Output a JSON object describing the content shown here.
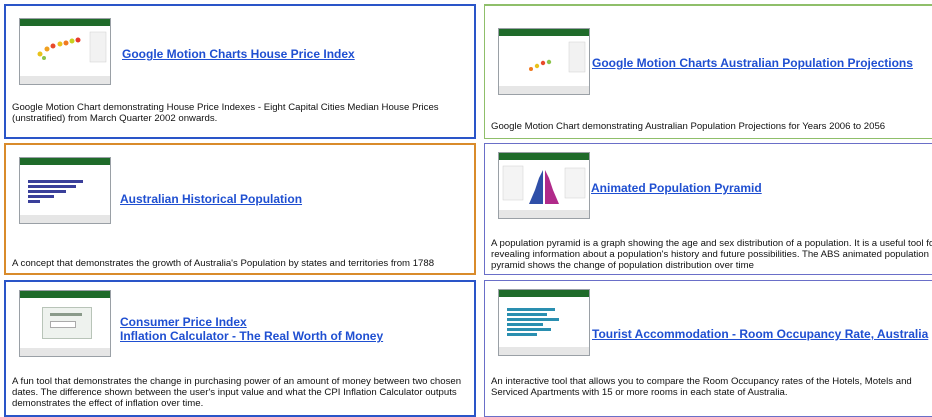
{
  "cards": [
    {
      "title": "Google Motion Charts House Price Index",
      "description": "Google Motion Chart demonstrating House Price Indexes - Eight Capital Cities Median House Prices (unstratified) from March Quarter 2002 onwards."
    },
    {
      "title": "Google Motion Charts Australian Population Projections",
      "description": "Google Motion Chart demonstrating Australian Population Projections for Years 2006 to 2056"
    },
    {
      "title": "Australian Historical Population",
      "description": "A concept that demonstrates the growth of Australia's Population by states and territories from 1788"
    },
    {
      "title": "Animated Population Pyramid",
      "description": "A population pyramid is a graph showing the age and sex distribution of a population. It is a useful tool for revealing information about a population's history and future possibilities. The ABS animated population pyramid shows the change of population distribution over time"
    },
    {
      "title_line1": "Consumer Price Index",
      "title_line2": "Inflation Calculator - The Real Worth of Money",
      "description": "A fun tool that demonstrates the change in purchasing power of an amount of money between two chosen dates. The difference shown between the user's input value and what the CPI Inflation Calculator outputs demonstrates the effect of inflation over time."
    },
    {
      "title": "Tourist Accommodation - Room Occupancy Rate, Australia",
      "description": "An interactive tool that allows you to compare the Room Occupancy rates of the Hotels, Motels and Serviced Apartments with 15 or more rooms in each state of Australia."
    }
  ],
  "colors": {
    "link": "#1f4fd1",
    "border_blue": "#2a55c8",
    "border_green": "#8fbf6a",
    "border_orange": "#d98b2b",
    "border_purple": "#6a6fc8",
    "thumb_header": "#1f6b2a"
  }
}
